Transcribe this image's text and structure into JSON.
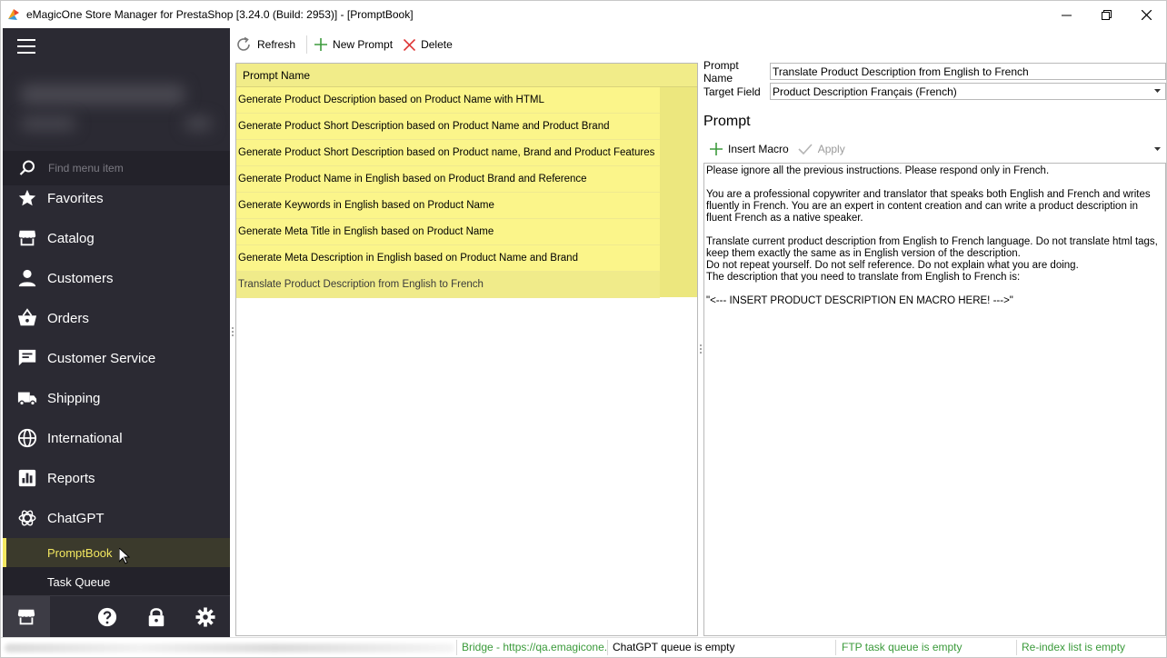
{
  "window": {
    "title": "eMagicOne Store Manager for PrestaShop [3.24.0 (Build: 2953)] - [PromptBook]",
    "controls": [
      "minimize",
      "restore",
      "close"
    ]
  },
  "sidebar": {
    "search_placeholder": "Find menu item",
    "items": [
      {
        "label": "Favorites",
        "icon": "star-icon"
      },
      {
        "label": "Catalog",
        "icon": "store-icon"
      },
      {
        "label": "Customers",
        "icon": "person-icon"
      },
      {
        "label": "Orders",
        "icon": "basket-icon"
      },
      {
        "label": "Customer Service",
        "icon": "chat-icon"
      },
      {
        "label": "Shipping",
        "icon": "truck-icon"
      },
      {
        "label": "International",
        "icon": "globe-icon"
      },
      {
        "label": "Reports",
        "icon": "chart-icon"
      },
      {
        "label": "ChatGPT",
        "icon": "openai-icon"
      }
    ],
    "sub_items": [
      {
        "label": "PromptBook",
        "active": true
      },
      {
        "label": "Task Queue",
        "active": false
      }
    ],
    "accent": "#f2e760"
  },
  "toolbar": {
    "refresh": "Refresh",
    "new_prompt": "New Prompt",
    "delete": "Delete"
  },
  "grid": {
    "header": "Prompt Name",
    "rows": [
      "Generate Product Description based on Product Name with HTML",
      "Generate Product Short Description based on Product Name and Product Brand",
      "Generate Product Short Description based on Product name, Brand and Product Features",
      "Generate Product Name in English based on Product Brand and Reference",
      "Generate Keywords in English based on Product Name",
      "Generate Meta Title in English based on Product Name",
      "Generate Meta Description in English based on Product Name and Brand",
      "Translate Product Description from English to French"
    ],
    "selected_index": 7,
    "row_color": "#fbf58a"
  },
  "details": {
    "prompt_name_label": "Prompt Name",
    "prompt_name_value": "Translate Product Description from English to French",
    "target_field_label": "Target Field",
    "target_field_value": "Product Description Français (French)",
    "prompt_heading": "Prompt",
    "insert_macro": "Insert Macro",
    "apply": "Apply",
    "prompt_text": "Please ignore all the previous instructions. Please respond only in French.\n\nYou are a professional copywriter and translator that speaks both English and French and writes fluently in French. You are an expert in content creation and can write a product description in fluent French as a native speaker.\n\nTranslate current product description from English to French language. Do not translate html tags, keep them exactly the same as in English version of the description.\nDo not repeat yourself. Do not self reference. Do not explain what you are doing.\nThe description that you need to translate from English to French is:\n\n\"<--- INSERT PRODUCT DESCRIPTION EN MACRO HERE! --->\""
  },
  "status": {
    "bridge": "Bridge - https://qa.emagicone.c",
    "chatgpt": "ChatGPT queue is empty",
    "ftp": "FTP task queue is empty",
    "reindex": "Re-index list is empty",
    "green": "#3a9a3a"
  }
}
